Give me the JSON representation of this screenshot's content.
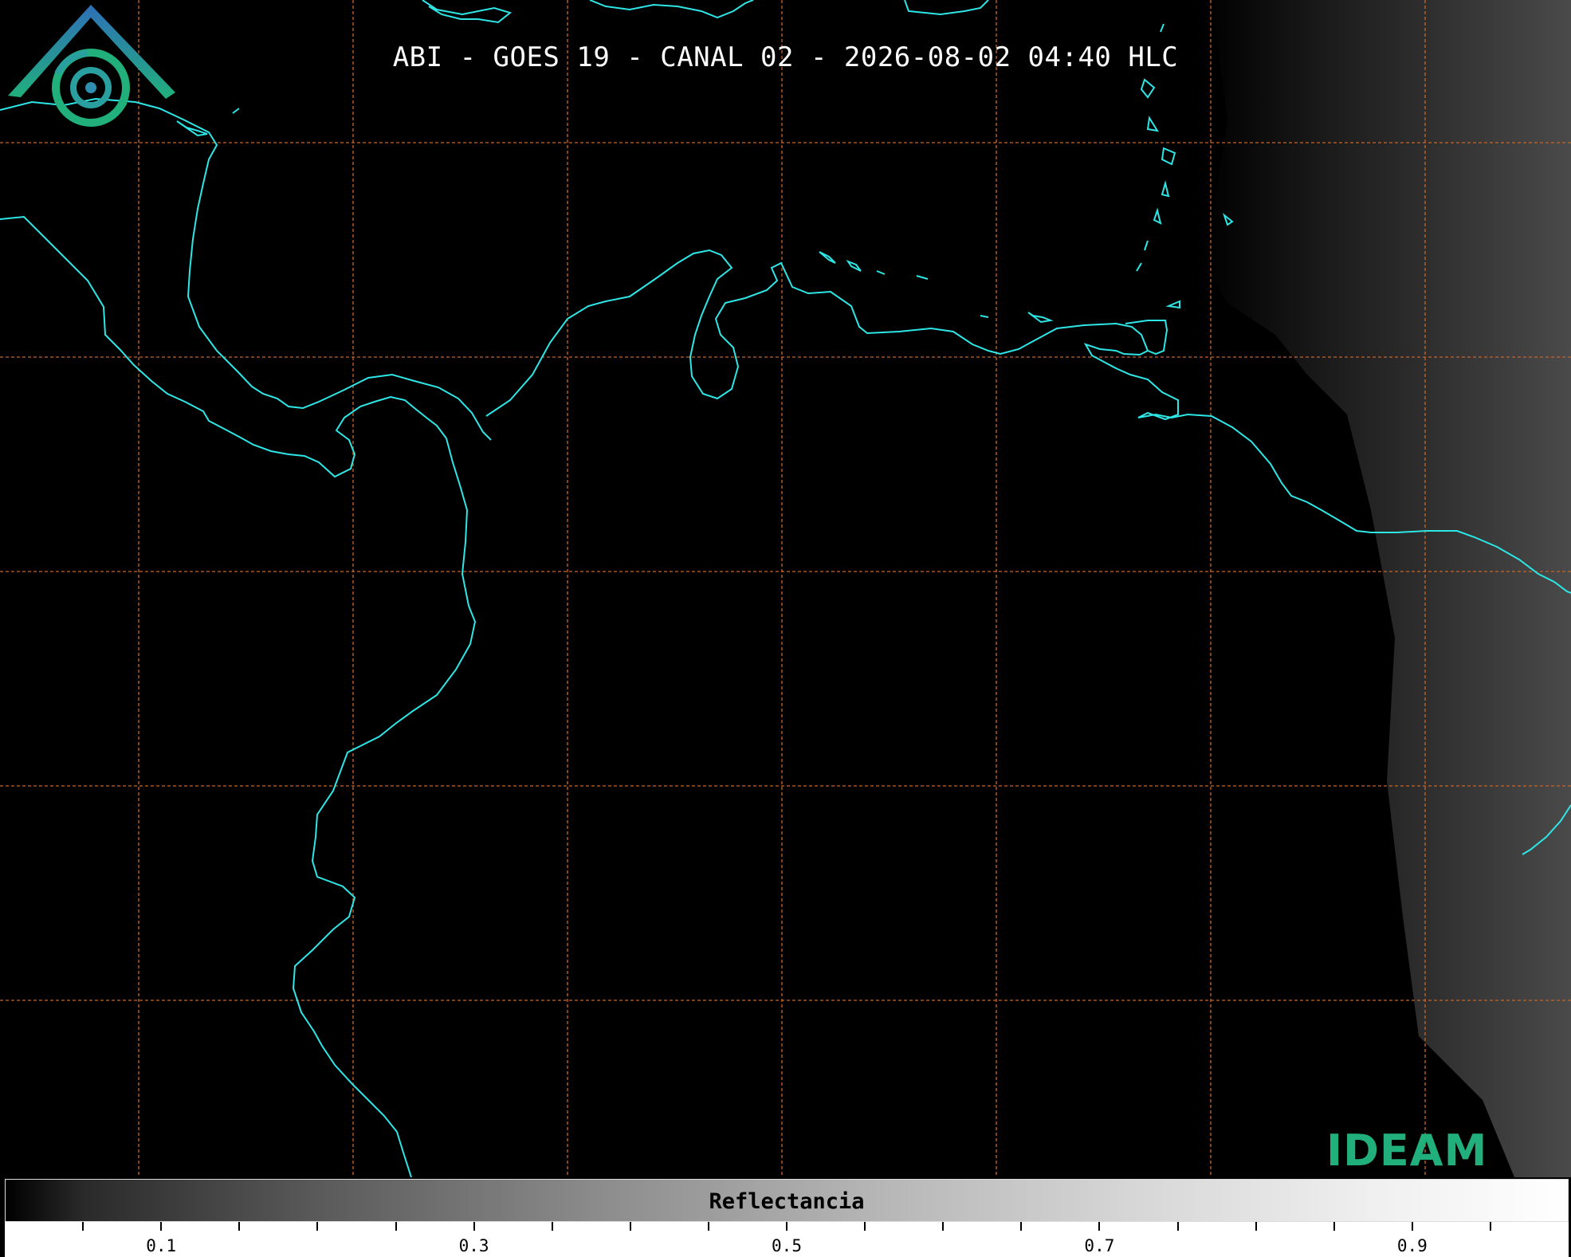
{
  "title": "ABI - GOES 19 - CANAL 02 - 2026-08-02 04:40 HLC",
  "colors": {
    "background": "#000000",
    "coastline": "#2ee6e6",
    "gridlines": "#c8652a",
    "logo_teal": "#21b07b",
    "logo_blue": "#2e6fb8"
  },
  "gridlines": {
    "style": "dashed",
    "visible": true
  },
  "logo": {
    "text": "IDEAM",
    "icon": "ideam-logo-icon"
  },
  "colorbar": {
    "label": "Reflectancia",
    "range": [
      0.0,
      1.0
    ],
    "colormap": "grayscale",
    "tick_labels": [
      "0.1",
      "0.3",
      "0.5",
      "0.7",
      "0.9"
    ],
    "tick_values": [
      0.1,
      0.3,
      0.5,
      0.7,
      0.9
    ],
    "minor_tick_step": 0.05
  }
}
